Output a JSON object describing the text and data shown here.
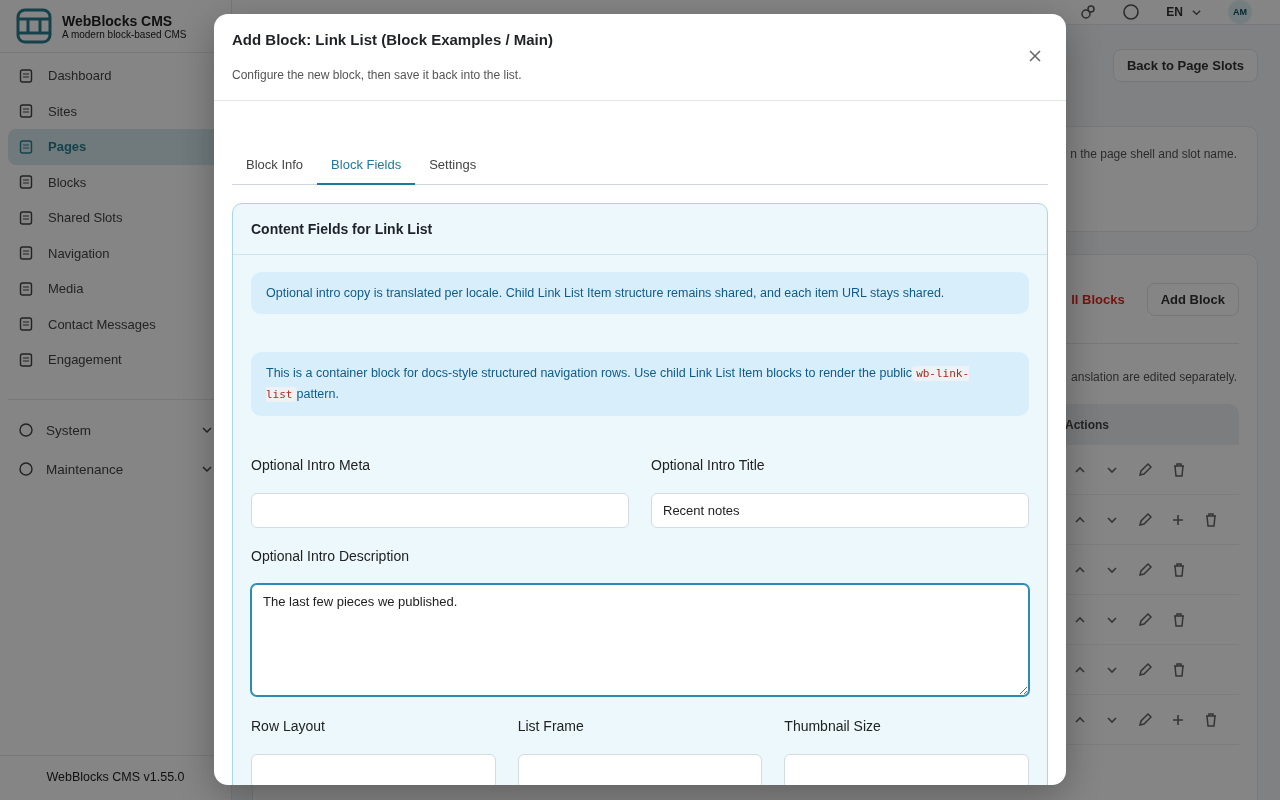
{
  "app": {
    "brand": "WebBlocks CMS",
    "tagline": "A modern block-based CMS",
    "version": "WebBlocks CMS v1.55.0"
  },
  "sidebar": {
    "items": [
      {
        "label": "Dashboard",
        "selected": false
      },
      {
        "label": "Sites",
        "selected": false
      },
      {
        "label": "Pages",
        "selected": true
      },
      {
        "label": "Blocks",
        "selected": false
      },
      {
        "label": "Shared Slots",
        "selected": false
      },
      {
        "label": "Navigation",
        "selected": false
      },
      {
        "label": "Media",
        "selected": false
      },
      {
        "label": "Contact Messages",
        "selected": false
      },
      {
        "label": "Engagement",
        "selected": false
      }
    ],
    "groups": [
      {
        "label": "System",
        "expanded": false
      },
      {
        "label": "Maintenance",
        "expanded": false
      }
    ]
  },
  "topbar": {
    "language": "EN",
    "avatar": "AM"
  },
  "page": {
    "back_button": "Back to Page Slots",
    "slot_note": "n the page shell and slot name.",
    "blocks_link": "ll Blocks",
    "add_block_button": "Add Block",
    "translation_note": "anslation are edited separately.",
    "table": {
      "columns": [
        "Actions"
      ],
      "rows": [
        {
          "can_add_child": false
        },
        {
          "can_add_child": true
        },
        {
          "can_add_child": false
        },
        {
          "can_add_child": false
        },
        {
          "can_add_child": false
        },
        {
          "can_add_child": true
        }
      ]
    }
  },
  "modal": {
    "title": "Add Block: Link List (Block Examples / Main)",
    "subtitle": "Configure the new block, then save it back into the list.",
    "tabs": [
      {
        "label": "Block Info",
        "selected": false
      },
      {
        "label": "Block Fields",
        "selected": true
      },
      {
        "label": "Settings",
        "selected": false
      }
    ],
    "section_title": "Content Fields for Link List",
    "notices": [
      {
        "text": "Optional intro copy is translated per locale. Child Link List Item structure remains shared, and each item URL stays shared."
      },
      {
        "text": "This is a container block for docs-style structured navigation rows. Use child Link List Item blocks to render the public",
        "code": "wb-link-list",
        "text_after": "pattern."
      }
    ],
    "fields": [
      {
        "kind": "text",
        "label": "Optional Intro Meta",
        "focused": false
      },
      {
        "kind": "text",
        "label": "Optional Intro Title",
        "value": "Recent notes",
        "focused": false
      },
      {
        "kind": "textarea",
        "label": "Optional Intro Description",
        "value": "The last few pieces we published.",
        "focused": true
      },
      {
        "kind": "select",
        "label": "Row Layout",
        "focused": false
      },
      {
        "kind": "select",
        "label": "List Frame",
        "focused": false
      },
      {
        "kind": "select",
        "label": "Thumbnail Size",
        "focused": false
      }
    ]
  }
}
